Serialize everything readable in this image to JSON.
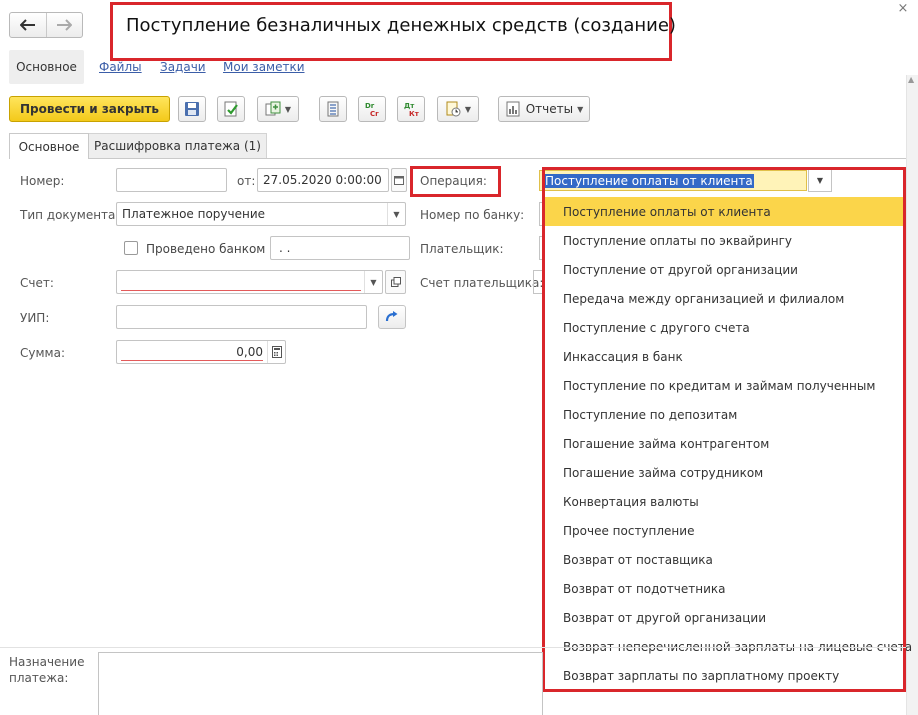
{
  "window": {
    "title": "Поступление безналичных денежных средств (создание)",
    "close_glyph": "×"
  },
  "top_tabs": {
    "active": "Основное",
    "links": [
      "Файлы",
      "Задачи",
      "Мои заметки"
    ]
  },
  "toolbar": {
    "post_and_close": "Провести и закрыть",
    "reports": "Отчеты",
    "dt_kt_label": "Дт\nКт",
    "dr_cr_label": "Dr\nCr"
  },
  "form_tabs": [
    "Основное",
    "Расшифровка платежа (1)"
  ],
  "form": {
    "number_label": "Номер:",
    "number_value": "",
    "date_label": "от:",
    "date_value": "27.05.2020  0:00:00",
    "operation_label": "Операция:",
    "operation_value": "Поступление оплаты от клиента",
    "doc_type_label": "Тип документа:",
    "doc_type_value": "Платежное поручение",
    "bank_number_label": "Номер по банку:",
    "posted_by_bank_label": "Проведено банком",
    "posted_by_bank_date": " .  .",
    "payer_label": "Плательщик:",
    "account_label": "Счет:",
    "account_value": "",
    "payer_account_label": "Счет плательщика:",
    "uip_label": "УИП:",
    "uip_value": "",
    "amount_label": "Сумма:",
    "amount_value": "0,00",
    "purpose_label_line1": "Назначение",
    "purpose_label_line2": "платежа:"
  },
  "operation_options": [
    "Поступление оплаты от клиента",
    "Поступление оплаты по эквайрингу",
    "Поступление от другой организации",
    "Передача между организацией и филиалом",
    "Поступление с другого счета",
    "Инкассация в банк",
    "Поступление по кредитам и займам полученным",
    "Поступление по депозитам",
    "Погашение займа контрагентом",
    "Погашение займа сотрудником",
    "Конвертация валюты",
    "Прочее поступление",
    "Возврат от поставщика",
    "Возврат от подотчетника",
    "Возврат от другой организации",
    "Возврат неперечисленной зарплаты на лицевые счета",
    "Возврат зарплаты по зарплатному проекту"
  ],
  "colors": {
    "accent_yellow": "#f3c91a",
    "highlight_red": "#d9262b",
    "selection_yellow": "#fbd54a",
    "link_blue": "#3b5ea8"
  }
}
